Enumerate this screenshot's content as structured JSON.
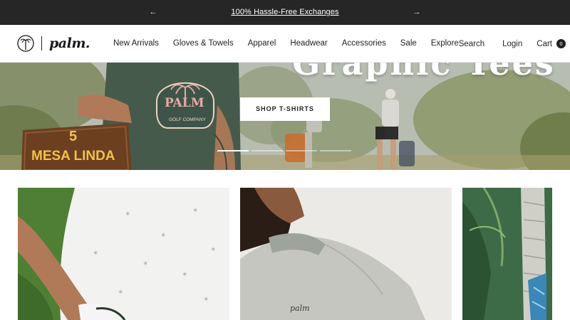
{
  "announcement": {
    "prev_icon": "arrow-left-icon",
    "next_icon": "arrow-right-icon",
    "prev_glyph": "←",
    "next_glyph": "→",
    "message": "100% Hassle-Free Exchanges"
  },
  "header": {
    "logo": {
      "icon": "palm-tree-logo-icon",
      "wordmark": "palm."
    },
    "nav": [
      {
        "label": "New Arrivals"
      },
      {
        "label": "Gloves & Towels"
      },
      {
        "label": "Apparel"
      },
      {
        "label": "Headwear"
      },
      {
        "label": "Accessories"
      },
      {
        "label": "Sale"
      },
      {
        "label": "Explore"
      }
    ],
    "search_label": "Search",
    "login_label": "Login",
    "cart_label": "Cart",
    "cart_count": "0"
  },
  "hero": {
    "title": "Graphic Tees",
    "cta_label": "SHOP T-SHIRTS",
    "slide_count": 4,
    "active_slide": 1,
    "shirt_graphic_text": "PALM",
    "shirt_graphic_subtext": "GOLF COMPANY",
    "sign_number": "5",
    "sign_text": "MESA LINDA"
  },
  "products": [
    {
      "name": "product-card-white-polo"
    },
    {
      "name": "product-card-grey-crewneck",
      "print_text": "palm"
    },
    {
      "name": "product-card-palm-print"
    }
  ],
  "colors": {
    "announcement_bg": "#262626",
    "text": "#1f1f1f",
    "sign_text": "#f2c04a",
    "shirt_green": "#465a4c"
  }
}
